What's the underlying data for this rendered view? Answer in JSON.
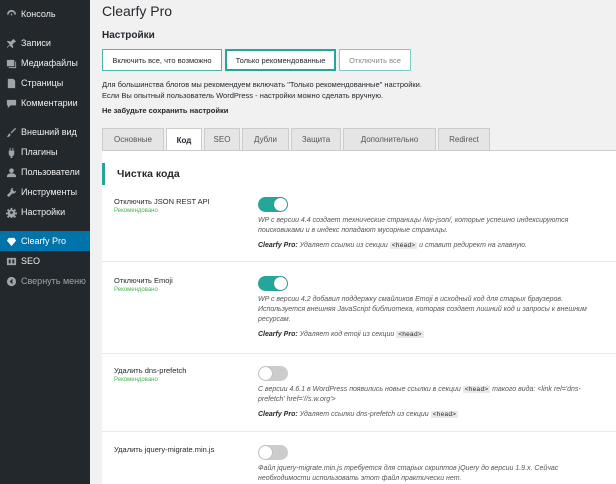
{
  "sidebar": {
    "items": [
      {
        "label": "Консоль",
        "icon": "dashboard-icon",
        "state": "normal"
      },
      {
        "label": "Записи",
        "icon": "pin-icon",
        "state": "normal"
      },
      {
        "label": "Медиафайлы",
        "icon": "media-icon",
        "state": "normal"
      },
      {
        "label": "Страницы",
        "icon": "page-icon",
        "state": "normal"
      },
      {
        "label": "Комментарии",
        "icon": "comment-icon",
        "state": "normal"
      },
      {
        "label": "Внешний вид",
        "icon": "brush-icon",
        "state": "normal"
      },
      {
        "label": "Плагины",
        "icon": "plugin-icon",
        "state": "normal"
      },
      {
        "label": "Пользователи",
        "icon": "user-icon",
        "state": "normal"
      },
      {
        "label": "Инструменты",
        "icon": "wrench-icon",
        "state": "normal"
      },
      {
        "label": "Настройки",
        "icon": "settings-icon",
        "state": "normal"
      },
      {
        "label": "Clearfy Pro",
        "icon": "diamond-icon",
        "state": "active"
      },
      {
        "label": "SEO",
        "icon": "seo-icon",
        "state": "normal"
      },
      {
        "label": "Свернуть меню",
        "icon": "collapse-icon",
        "state": "dim"
      }
    ]
  },
  "page": {
    "title": "Clearfy Pro",
    "settings_heading": "Настройки",
    "buttons": {
      "enable_all": "Включить все, что возможно",
      "recommended": "Только рекомендованные",
      "disable_all": "Отключить все"
    },
    "note_line1": "Для большинства блогов мы рекомендуем включать \"Только рекомендованные\" настройки.",
    "note_line2": "Если Вы опытный пользователь WordPress - настройки можно сделать вручную.",
    "save_reminder": "Не забудьте сохранить настройки"
  },
  "tabs": [
    {
      "label": "Основные",
      "active": false
    },
    {
      "label": "Код",
      "active": true
    },
    {
      "label": "SEO",
      "active": false
    },
    {
      "label": "Дубли",
      "active": false
    },
    {
      "label": "Защита",
      "active": false
    },
    {
      "label": "Дополнительно",
      "active": false
    },
    {
      "label": "Redirect",
      "active": false
    }
  ],
  "section": {
    "title": "Чистка кода",
    "rows": [
      {
        "label": "Отключить JSON REST API",
        "recommended": "Рекомендовано",
        "enabled": true,
        "desc": "WP с версии 4.4 создает технические страницы /wp-json/, которые успешно индексируются поисковиками и в индекс попадают мусорные страницы.",
        "brand": "Clearfy Pro:",
        "action_pre": "Удаляет ссылки из секции",
        "action_code": "<head>",
        "action_post": "и ставит редирект на главную."
      },
      {
        "label": "Отключить Emoji",
        "recommended": "Рекомендовано",
        "enabled": true,
        "desc": "WP с версии 4.2 добавил поддержку смайликов Emoji в исходный код для старых браузеров. Используется внешняя JavaScript библиотека, которая создает лишний код и запросы к внешним ресурсам.",
        "brand": "Clearfy Pro:",
        "action_pre": "Удаляет код emoji из секции",
        "action_code": "<head>",
        "action_post": ""
      },
      {
        "label": "Удалить dns-prefetch",
        "recommended": "Рекомендовано",
        "enabled": false,
        "desc_pre": "С версии 4.6.1 в WordPress появились новые ссылки в секции",
        "desc_code": "<head>",
        "desc_post": "такого вида: <link rel='dns-prefetch' href='//s.w.org'>",
        "brand": "Clearfy Pro:",
        "action_pre": "Удаляет ссылки dns-prefetch из секции",
        "action_code": "<head>",
        "action_post": ""
      },
      {
        "label": "Удалить jquery-migrate.min.js",
        "recommended": "",
        "enabled": false,
        "desc": "Файл jquery-migrate.min.js требуется для старых скриптов jQuery до версии 1.9.х. Сейчас необходимости использовать этот файл практически нет."
      }
    ]
  },
  "colors": {
    "sidebar_bg": "#23282d",
    "active_menu": "#0073aa",
    "accent_teal": "#26a69a",
    "recommended_green": "#46b450"
  }
}
